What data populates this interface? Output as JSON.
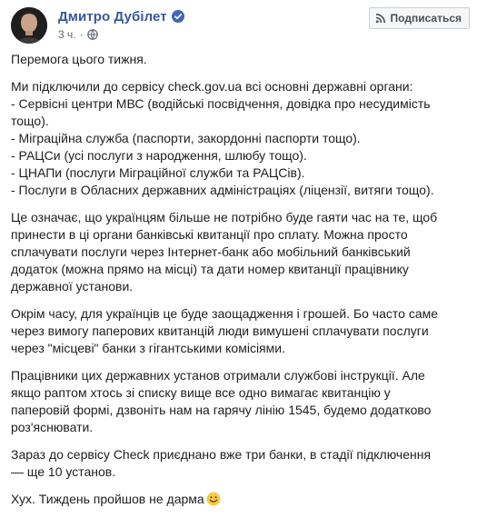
{
  "post": {
    "author": "Дмитро Дубілет",
    "time": "3 ч.",
    "dot": "·",
    "subscribe_label": "Подписаться",
    "colors": {
      "author_link": "#385898",
      "verified": "#4267b2",
      "meta": "#606770",
      "text": "#1c1e21",
      "button_bg": "#f5f6f7",
      "button_border": "#ccd0d5"
    },
    "icons": {
      "verified": "verified-badge-icon",
      "privacy": "globe-icon",
      "subscribe": "rss-icon",
      "emoji": "smiley-emoji-icon"
    },
    "paragraphs": [
      {
        "lines": [
          "Перемога цього тижня."
        ]
      },
      {
        "lines": [
          "Ми підключили до сервісу check.gov.ua всі основні державні органи:",
          "- Сервісні центри МВС (водійські посвідчення, довідка про несудимість",
          "тощо).",
          "- Міграційна служба (паспорти, закордонні паспорти тощо).",
          "- РАЦСи (усі послуги з народження, шлюбу тощо).",
          "- ЦНАПи (послуги Міграційної служби та РАЦСів).",
          "- Послуги в Обласних державних адміністраціях (ліцензії, витяги тощо)."
        ]
      },
      {
        "lines": [
          "Це означає, що українцям більше не потрібно буде гаяти час на те, щоб",
          "принести в ці органи банківські квитанції про сплату. Можна просто",
          "сплачувати послуги через Інтернет-банк або мобільний банківський",
          "додаток (можна прямо на місці) та дати номер квитанції працівнику",
          "державної установи."
        ]
      },
      {
        "lines": [
          "Окрім часу, для українців це буде заощадження і грошей. Бо часто саме",
          "через вимогу паперових квитанцій люди вимушені сплачувати послуги",
          "через \"місцеві\" банки з гігантськими комісіями."
        ]
      },
      {
        "lines": [
          "Працівники цих державних установ отримали службові інструкції. Але",
          "якщо раптом хтось зі списку вище все одно вимагає квитанцію у",
          "паперовій формі, дзвоніть нам на гарячу лінію 1545, будемо додатково",
          "роз'яснювати."
        ]
      },
      {
        "lines": [
          "Зараз до сервісу Check приєднано вже три банки, в стадії підключення",
          "— ще 10 установ."
        ]
      },
      {
        "lines": [
          "Хух. Тиждень пройшов не дарма"
        ]
      }
    ]
  }
}
